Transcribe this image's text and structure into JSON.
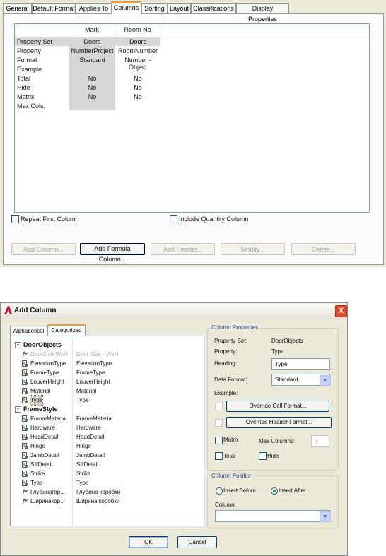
{
  "top": {
    "tabs": [
      "General",
      "Default Format",
      "Applies To",
      "Columns",
      "Sorting",
      "Layout",
      "Classifications",
      "Display Properties"
    ],
    "active_tab": "Columns",
    "grid": {
      "columns": [
        "Mark",
        "Room No"
      ],
      "row_labels": [
        "Property Set",
        "Property",
        "Format",
        "Example",
        "Total",
        "Hide",
        "Matrix",
        "Max Cols."
      ],
      "col1": [
        "Doors",
        "NumberProject",
        "Standard",
        "",
        "No",
        "No",
        "No",
        ""
      ],
      "col2": [
        "Doors",
        "RoomNumber",
        "Number - Object",
        "",
        "No",
        "No",
        "No",
        ""
      ]
    },
    "repeat_first_column": "Repeat First Column",
    "include_quantity_column": "Include Quantity Column",
    "buttons": {
      "add_column": "Add Column...",
      "add_formula_column": "Add Formula Column...",
      "add_header": "Add Header...",
      "modify": "Modify...",
      "delete": "Delete..."
    }
  },
  "dialog": {
    "title": "Add Column",
    "close": "X",
    "tabs": [
      "Alphabetical",
      "Categorized"
    ],
    "active_tab": "Categorized",
    "groups": [
      {
        "name": "DoorObjects",
        "items": [
          {
            "name": "DoorSize-WxH",
            "value": "Door Size - WxH",
            "disabled": true,
            "icon": "formula-icon"
          },
          {
            "name": "ElevationType",
            "value": "ElevationType",
            "icon": "property-icon"
          },
          {
            "name": "FrameType",
            "value": "FrameType",
            "icon": "property-icon"
          },
          {
            "name": "LouverHeight",
            "value": "LouverHeight",
            "icon": "property-icon"
          },
          {
            "name": "Material",
            "value": "Material",
            "icon": "property-icon"
          },
          {
            "name": "Type",
            "value": "Type",
            "selected": true,
            "icon": "property-icon"
          }
        ]
      },
      {
        "name": "FrameStyle",
        "items": [
          {
            "name": "FrameMaterial",
            "value": "FrameMaterial",
            "icon": "property-icon"
          },
          {
            "name": "Hardware",
            "value": "Hardware",
            "icon": "property-icon"
          },
          {
            "name": "HeadDetail",
            "value": "HeadDetail",
            "icon": "property-icon"
          },
          {
            "name": "Hinge",
            "value": "Hinge",
            "icon": "property-icon"
          },
          {
            "name": "JambDetail",
            "value": "JambDetail",
            "icon": "property-icon"
          },
          {
            "name": "SillDetail",
            "value": "SillDetail",
            "icon": "property-icon"
          },
          {
            "name": "Strike",
            "value": "Strike",
            "icon": "property-icon"
          },
          {
            "name": "Type",
            "value": "Type",
            "icon": "property-icon"
          },
          {
            "name": "Глубинагор...",
            "value": "Глубина коробки",
            "icon": "formula-icon"
          },
          {
            "name": "Ширинакор...",
            "value": "Ширина коробки",
            "icon": "formula-icon"
          }
        ]
      }
    ],
    "column_properties": {
      "legend": "Column Properties",
      "property_set_label": "Property Set:",
      "property_set_value": "DoorObjects",
      "property_label": "Property:",
      "property_value": "Type",
      "heading_label": "Heading:",
      "heading_value": "Type",
      "data_format_label": "Data Format:",
      "data_format_value": "Standard",
      "example_label": "Example:",
      "override_cell_format": "Override Cell Format...",
      "override_header_format": "Override Header Format...",
      "matrix_label": "Matrix",
      "max_columns_label": "Max Columns:",
      "max_columns_value": "3",
      "total_label": "Total",
      "hide_label": "Hide"
    },
    "column_position": {
      "legend": "Column Position",
      "insert_before": "Insert Before",
      "insert_after": "Insert After",
      "selected": "insert_after",
      "column_label": "Column:",
      "column_value": ""
    },
    "ok": "OK",
    "cancel": "Cancel",
    "colors": {
      "accent": "#e6a23c",
      "title_close": "#e0492b",
      "border": "#7f9db9"
    }
  }
}
